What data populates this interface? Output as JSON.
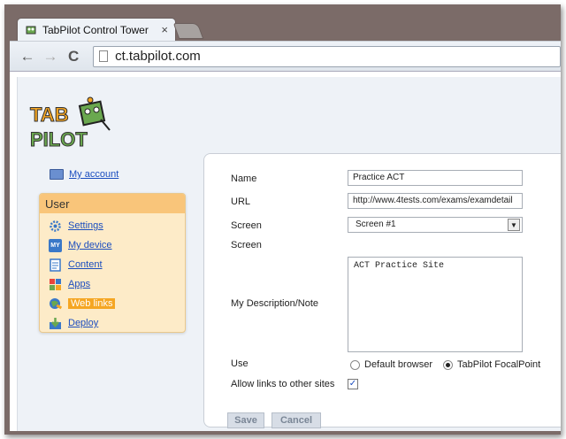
{
  "browser": {
    "tab_title": "TabPilot Control Tower",
    "tab_close": "×",
    "back_glyph": "←",
    "forward_glyph": "→",
    "reload_glyph": "C",
    "url": "ct.tabpilot.com"
  },
  "logo": {
    "line1": "TAB",
    "line2": "PILOT"
  },
  "sidebar": {
    "my_account": "My account",
    "section_title": "User",
    "items": [
      {
        "label": "Settings",
        "icon": "gear-icon"
      },
      {
        "label": "My device",
        "icon": "device-icon",
        "icon_text": "MY"
      },
      {
        "label": "Content",
        "icon": "content-icon"
      },
      {
        "label": "Apps",
        "icon": "apps-icon"
      },
      {
        "label": "Web links",
        "icon": "web-links-icon",
        "active": true
      },
      {
        "label": "Deploy",
        "icon": "deploy-icon"
      }
    ]
  },
  "form": {
    "name_label": "Name",
    "name_value": "Practice ACT",
    "url_label": "URL",
    "url_value": "http://www.4tests.com/exams/examdetail",
    "screen_label": "Screen",
    "screen_value": "Screen #1",
    "screen_label_2": "Screen",
    "description_label": "My Description/Note",
    "description_value": "ACT Practice Site",
    "use_label": "Use",
    "use_options": [
      "Default browser",
      "TabPilot FocalPoint"
    ],
    "use_selected": "TabPilot FocalPoint",
    "allow_links_label": "Allow links to other sites",
    "allow_links_checked": true,
    "checkbox_glyph": "✓",
    "select_arrow": "▼",
    "save_label": "Save",
    "cancel_label": "Cancel"
  },
  "colors": {
    "accent_orange": "#f9c57a",
    "active_item": "#f5a623",
    "link_blue": "#1a4dbf"
  }
}
